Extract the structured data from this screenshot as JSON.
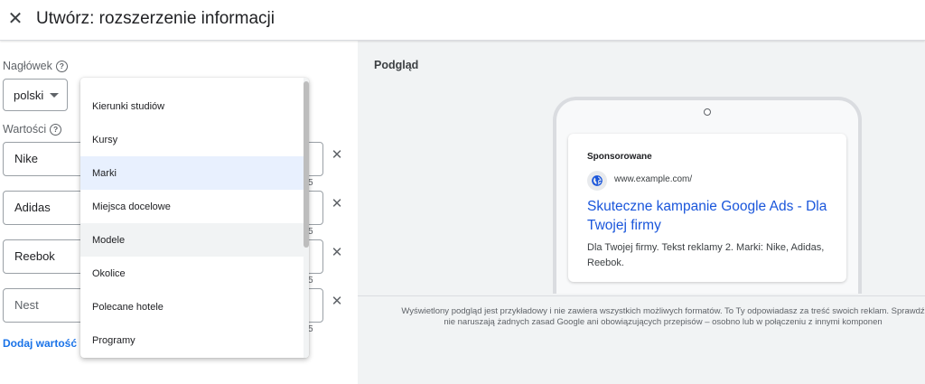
{
  "header": {
    "title": "Utwórz: rozszerzenie informacji",
    "close_icon": "close-icon"
  },
  "form": {
    "header_label": "Nagłówek",
    "language_select": "polski",
    "values_label": "Wartości",
    "values": [
      {
        "value": "Nike",
        "counter": "5"
      },
      {
        "value": "Adidas",
        "counter": "5"
      },
      {
        "value": "Reebok",
        "counter": "5"
      },
      {
        "value": "Nest",
        "counter": "5"
      }
    ],
    "add_value": "Dodaj wartość"
  },
  "dropdown": {
    "options": [
      "Kierunki studiów",
      "Kursy",
      "Marki",
      "Miejsca docelowe",
      "Modele",
      "Okolice",
      "Polecane hotele",
      "Programy"
    ],
    "selected": "Marki",
    "hovered": "Modele"
  },
  "preview": {
    "title": "Podgląd",
    "sponsored": "Sponsorowane",
    "url": "www.example.com/",
    "headline": "Skuteczne kampanie Google Ads - Dla Twojej firmy",
    "description": "Dla Twojej firmy. Tekst reklamy 2. Marki: Nike, Adidas, Reebok.",
    "disclaimer_line1": "Wyświetlony podgląd jest przykładowy i nie zawiera wszystkich możliwych formatów. To Ty odpowiadasz za treść swoich reklam. Sprawdź",
    "disclaimer_line2": "nie naruszają żadnych zasad Google ani obowiązujących przepisów – osobno lub w połączeniu z innymi komponen"
  },
  "colors": {
    "accent": "#1a73e8",
    "selected": "#e8f0fe",
    "preview_bg": "#f1f3f4"
  }
}
